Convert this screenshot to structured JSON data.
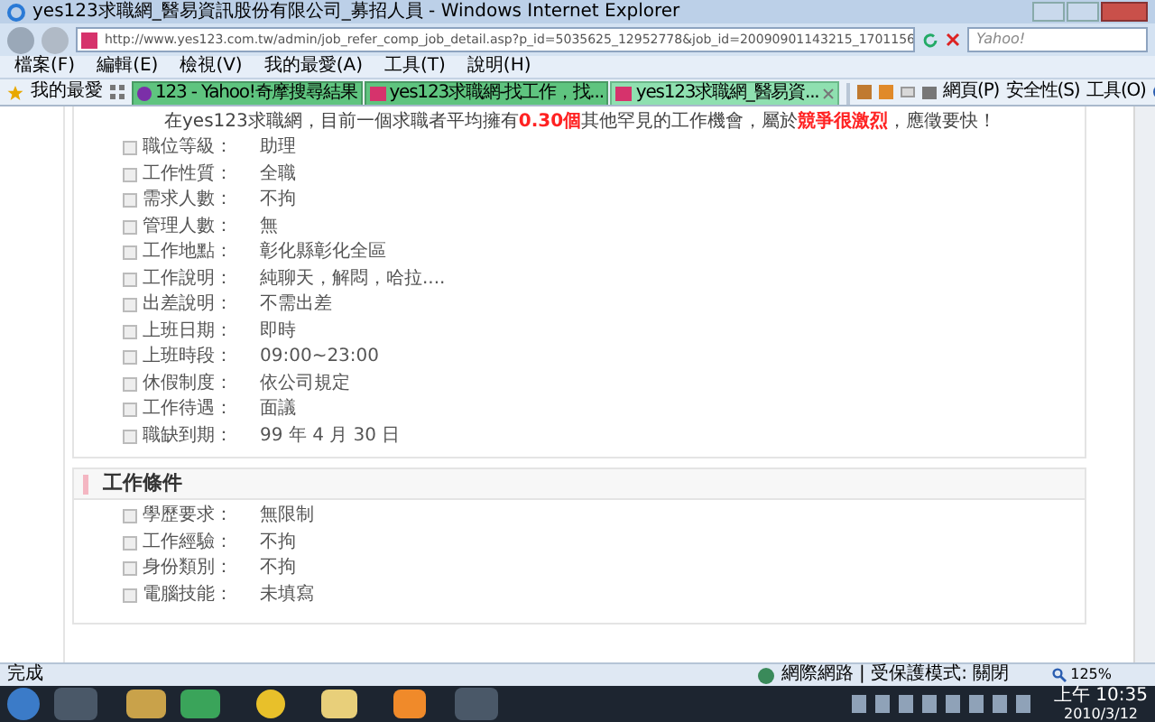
{
  "window": {
    "title": "yes123求職網_醫易資訊股份有限公司_募招人員 - Windows Internet Explorer"
  },
  "address_bar": {
    "url": "http://www.yes123.com.tw/admin/job_refer_comp_job_detail.asp?p_id=5035625_12952778&job_id=20090901143215_1701156"
  },
  "search": {
    "placeholder": "Yahoo!"
  },
  "menu": [
    "檔案(F)",
    "編輯(E)",
    "檢視(V)",
    "我的最愛(A)",
    "工具(T)",
    "說明(H)"
  ],
  "favorites": {
    "label": "我的最愛"
  },
  "tabs": [
    {
      "label": "123 - Yahoo!奇摩搜尋結果",
      "kind": "yahoo",
      "selected": false
    },
    {
      "label": "yes123求職網-找工作，找...",
      "kind": "yes123",
      "selected": false
    },
    {
      "label": "yes123求職網_醫易資...",
      "kind": "yes123",
      "selected": true
    }
  ],
  "command_bar": [
    "網頁(P)",
    "安全性(S)",
    "工具(O)"
  ],
  "notice": "在yes123求職網，目前一個求職者平均擁有**0.30個**其他罕見的工作機會，屬於**競爭很激烈**，應徵要快！",
  "job_details": [
    {
      "label": "職位等級：",
      "value": "助理"
    },
    {
      "label": "工作性質：",
      "value": "全職"
    },
    {
      "label": "需求人數：",
      "value": "不拘"
    },
    {
      "label": "管理人數：",
      "value": "無"
    },
    {
      "label": "工作地點：",
      "value": "彰化縣彰化全區"
    },
    {
      "label": "工作說明：",
      "value": "純聊天，解悶，哈拉...."
    },
    {
      "label": "出差說明：",
      "value": "不需出差"
    },
    {
      "label": "上班日期：",
      "value": "即時"
    },
    {
      "label": "上班時段：",
      "value": "09:00~23:00"
    },
    {
      "label": "休假制度：",
      "value": "依公司規定"
    },
    {
      "label": "工作待遇：",
      "value": "面議"
    },
    {
      "label": "職缺到期：",
      "value": "99 年 4 月 30 日"
    }
  ],
  "conditions": {
    "title": "工作條件",
    "items": [
      {
        "label": "學歷要求：",
        "value": "無限制"
      },
      {
        "label": "工作經驗：",
        "value": "不拘"
      },
      {
        "label": "身份類別：",
        "value": "不拘"
      },
      {
        "label": "電腦技能：",
        "value": "未填寫"
      }
    ]
  },
  "status_bar": {
    "text": "完成",
    "zone": "網際網路 | 受保護模式: 關閉",
    "zoom": "125%"
  },
  "clock": {
    "time": "上午 10:35",
    "date": "2010/3/12"
  }
}
